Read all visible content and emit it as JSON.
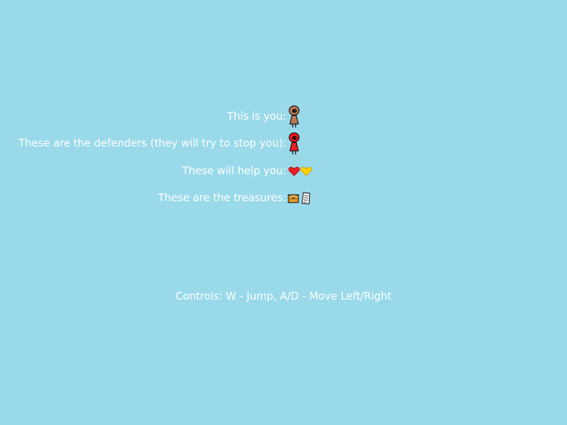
{
  "screen": {
    "background_color": "#99d9ea",
    "text_color": "#ffffff"
  },
  "legend": {
    "player": {
      "label": "This is you:",
      "icon": "player-character-icon",
      "color": "#b97a57"
    },
    "defenders": {
      "label": "These are the defenders (they will try to stop you):",
      "icon": "defender-character-icon",
      "color": "#ed1c24"
    },
    "helpers": {
      "label": "These will help you:",
      "icons": [
        "red-heart-icon",
        "yellow-heart-icon"
      ],
      "colors": [
        "#ed1c24",
        "#ffd200"
      ]
    },
    "treasures": {
      "label": "These are the treasures:",
      "icons": [
        "treasure-chest-icon",
        "scroll-document-icon"
      ]
    }
  },
  "controls": {
    "text": "Controls: W - Jump, A/D - Move Left/Right"
  }
}
